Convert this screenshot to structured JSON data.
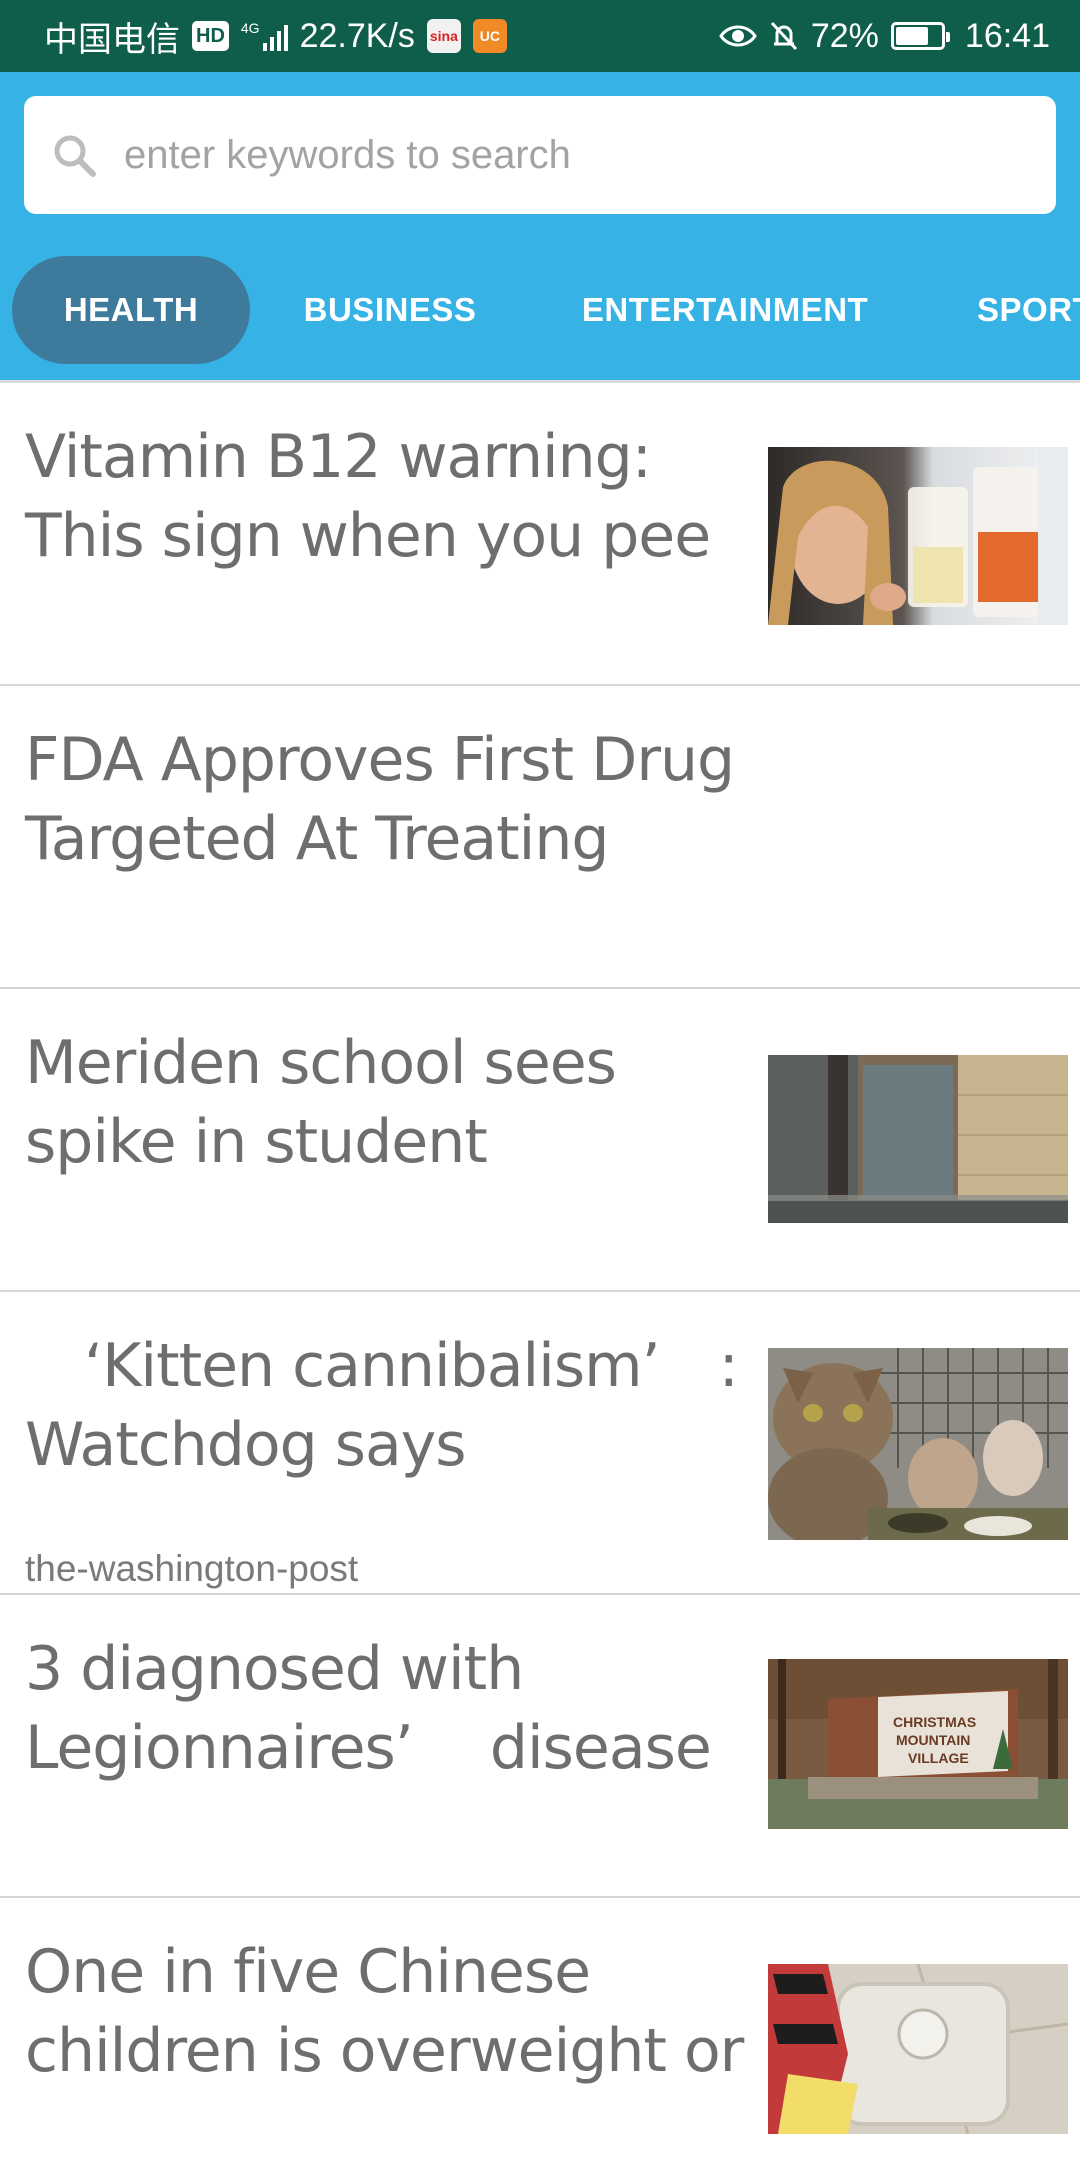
{
  "status_bar": {
    "carrier": "中国电信",
    "hd_badge": "HD",
    "network": "4G",
    "speed": "22.7K/s",
    "apps": [
      "sina",
      "UC"
    ],
    "battery_percent": "72%",
    "battery_level": 0.72,
    "time": "16:41"
  },
  "search": {
    "placeholder": "enter keywords to search"
  },
  "tabs": [
    {
      "label": "HEALTH",
      "active": true
    },
    {
      "label": "BUSINESS",
      "active": false
    },
    {
      "label": "ENTERTAINMENT",
      "active": false
    },
    {
      "label": "SPORTS",
      "active": false
    }
  ],
  "articles": [
    {
      "title": "Vitamin B12 warning: This sign when you pee",
      "source": "",
      "has_image": true
    },
    {
      "title": "FDA Approves First Drug Targeted At Treating",
      "source": "",
      "has_image": false
    },
    {
      "title": "Meriden school sees spike in student",
      "source": "",
      "has_image": true
    },
    {
      "title": "　‘Kitten cannibalism’　: Watchdog says",
      "source": "the-washington-post",
      "has_image": true
    },
    {
      "title": "3 diagnosed with Legionnaires’　 disease",
      "source": "",
      "has_image": true,
      "image_sign_text": [
        "CHRISTMAS",
        "MOUNTAIN",
        "VILLAGE"
      ]
    },
    {
      "title": "One in five Chinese children is overweight or",
      "source": "",
      "has_image": true
    }
  ],
  "colors": {
    "status_bar": "#0f5e4c",
    "header": "#37b2e5",
    "active_tab": "#3d7a9c",
    "title_text": "#6e6e6e"
  }
}
